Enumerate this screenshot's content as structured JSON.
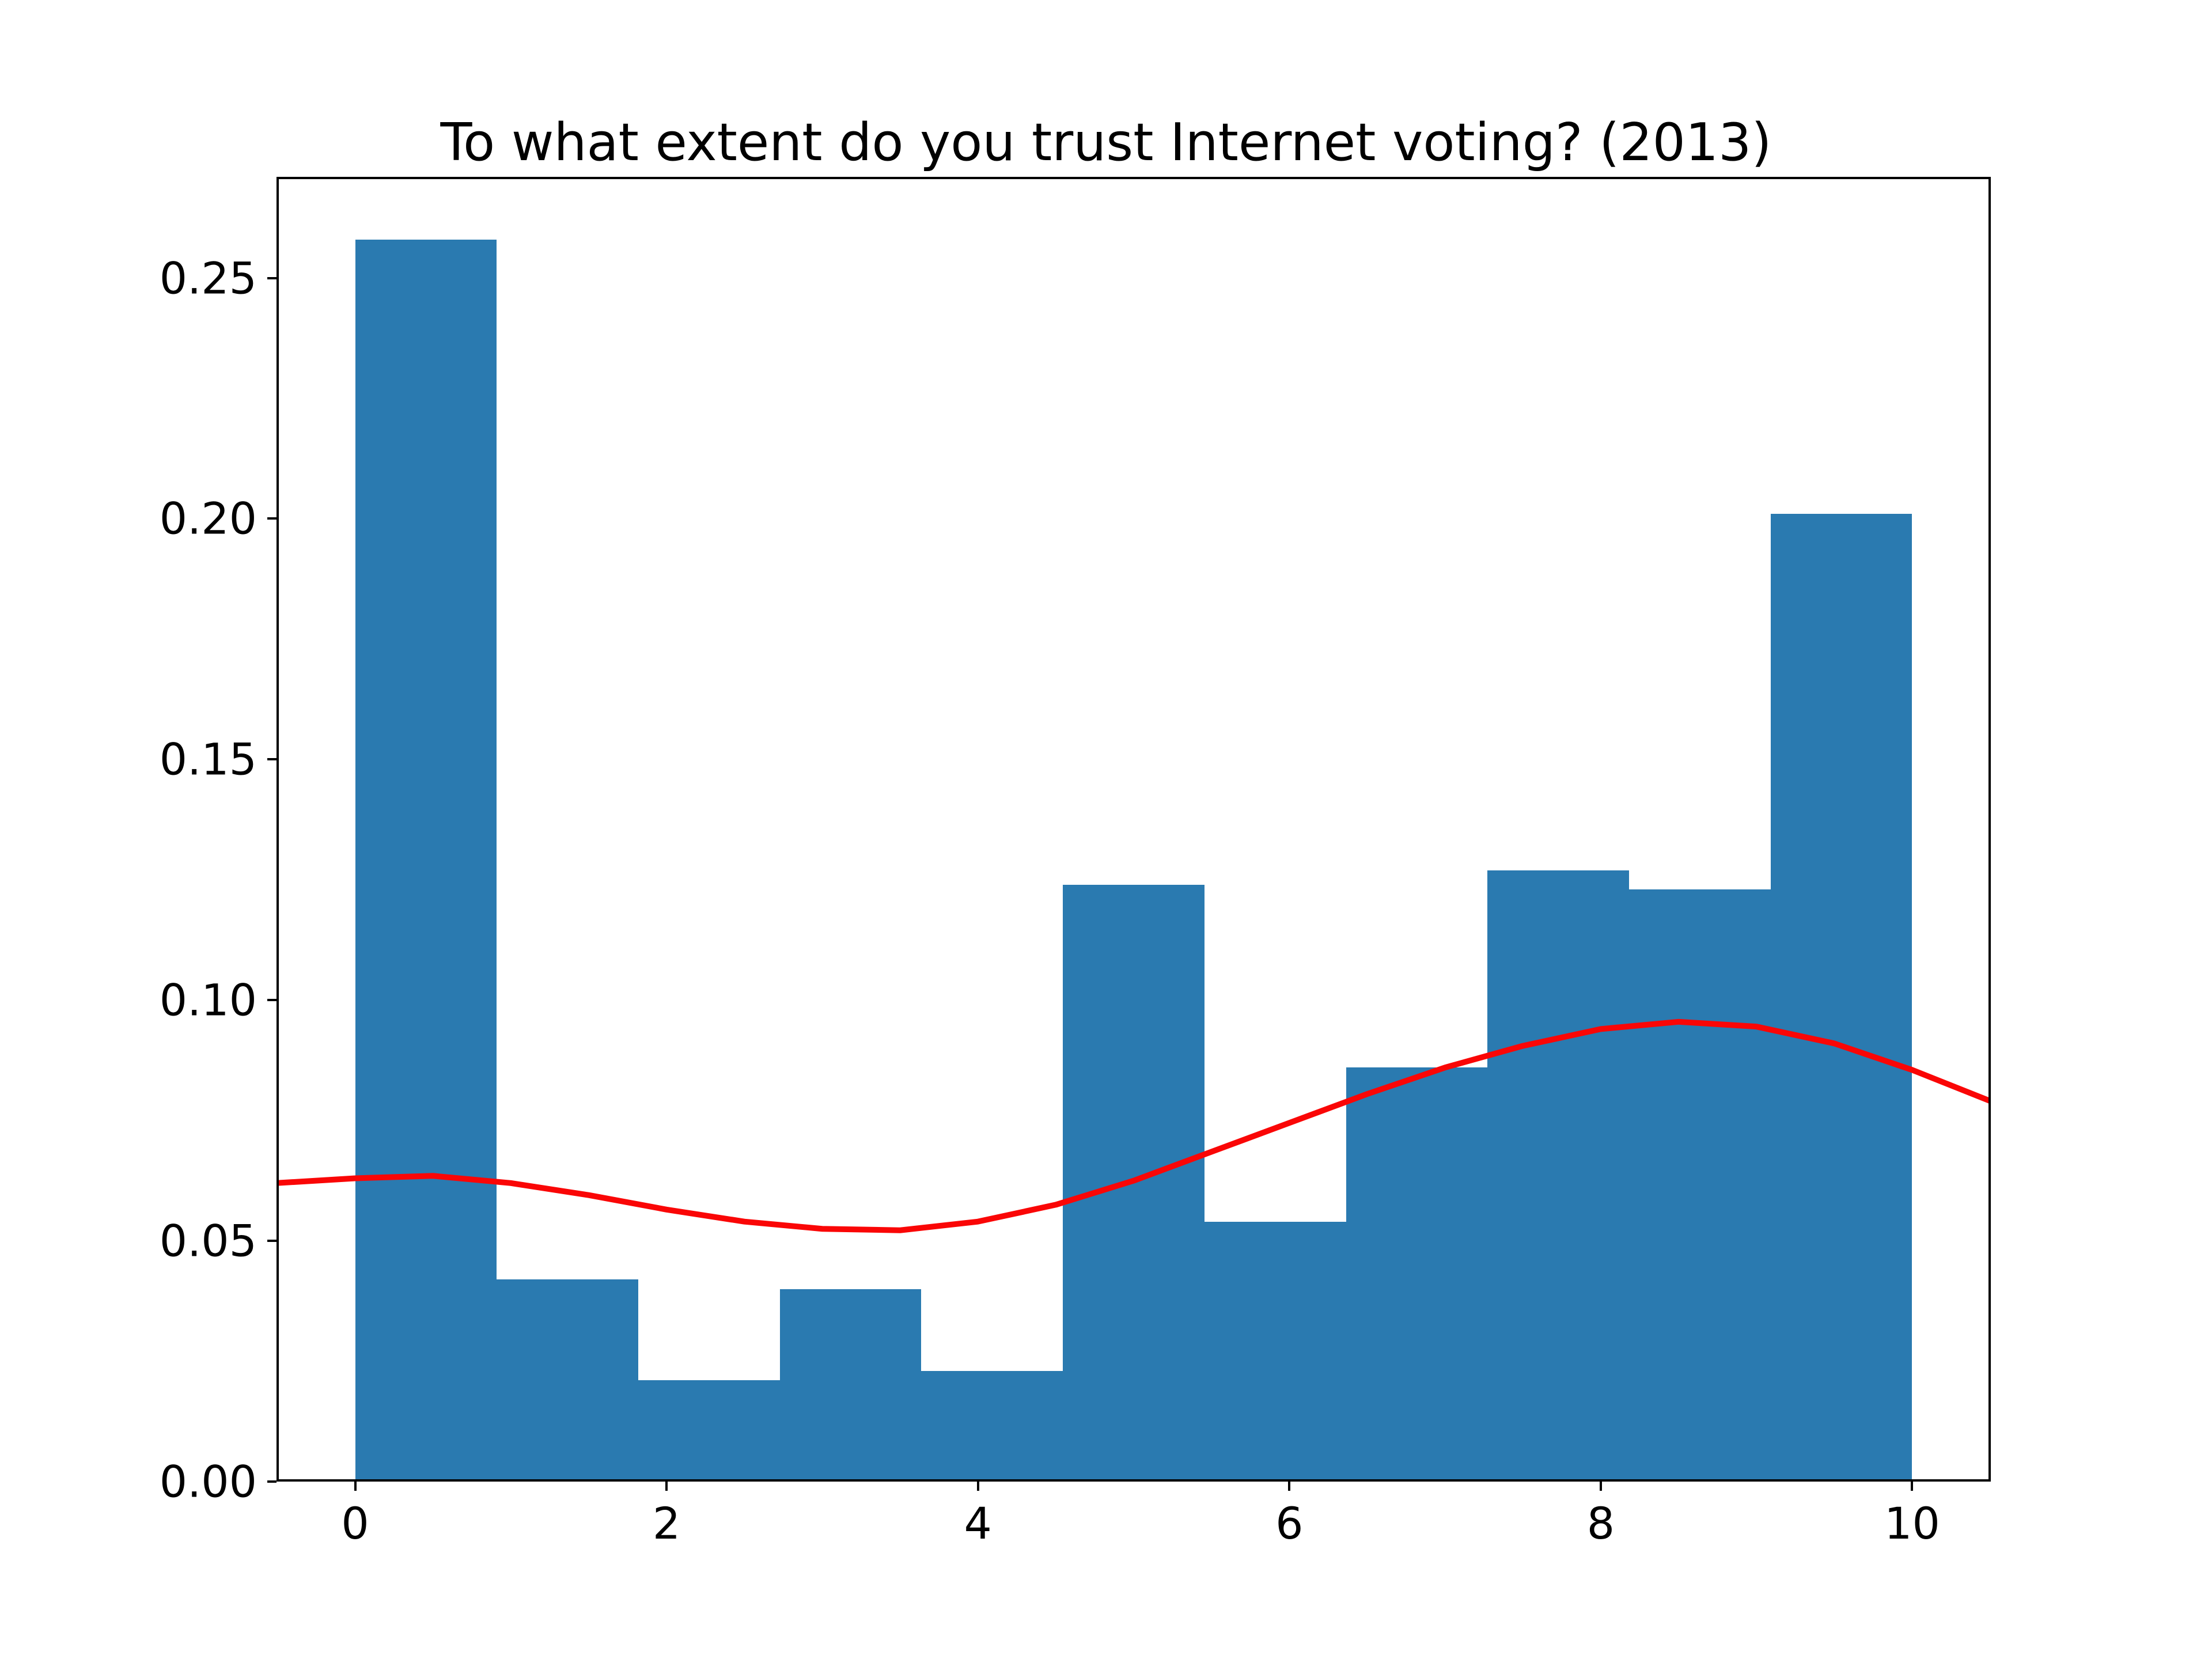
{
  "chart_data": {
    "type": "bar",
    "title": "To what extent do you trust Internet voting? (2013)",
    "xlabel": "",
    "ylabel": "",
    "categories": [
      "0",
      "1",
      "2",
      "3",
      "4",
      "5",
      "6",
      "7",
      "8",
      "9",
      "10"
    ],
    "values": [
      0.258,
      0.042,
      0.021,
      0.04,
      0.023,
      0.124,
      0.054,
      0.086,
      0.127,
      0.123,
      0.201
    ],
    "xlim": [
      -0.505,
      10.505
    ],
    "ylim": [
      0.0,
      0.271
    ],
    "x_ticks": [
      0,
      2,
      4,
      6,
      8,
      10
    ],
    "y_ticks": [
      0.0,
      0.05,
      0.1,
      0.15,
      0.2,
      0.25
    ],
    "y_tick_labels": [
      "0.00",
      "0.05",
      "0.10",
      "0.15",
      "0.20",
      "0.25"
    ],
    "kde": {
      "x": [
        -0.505,
        0,
        0.5,
        1,
        1.5,
        2,
        2.5,
        3,
        3.5,
        4,
        4.5,
        5,
        5.5,
        6,
        6.5,
        7,
        7.5,
        8,
        8.5,
        9,
        9.5,
        10,
        10.505
      ],
      "y": [
        0.062,
        0.063,
        0.0635,
        0.062,
        0.0595,
        0.0565,
        0.054,
        0.0525,
        0.0522,
        0.054,
        0.0575,
        0.0625,
        0.0685,
        0.0745,
        0.0805,
        0.086,
        0.0905,
        0.094,
        0.0955,
        0.0945,
        0.091,
        0.0855,
        0.079
      ],
      "color": "#fa0606",
      "linewidth": 10
    },
    "bar_color": "#2a7ab0",
    "layout": {
      "fig_w": 3840,
      "fig_h": 2880,
      "ax_left": 480,
      "ax_top": 307,
      "ax_w": 2976,
      "ax_h": 2265,
      "title_top": 195
    }
  }
}
